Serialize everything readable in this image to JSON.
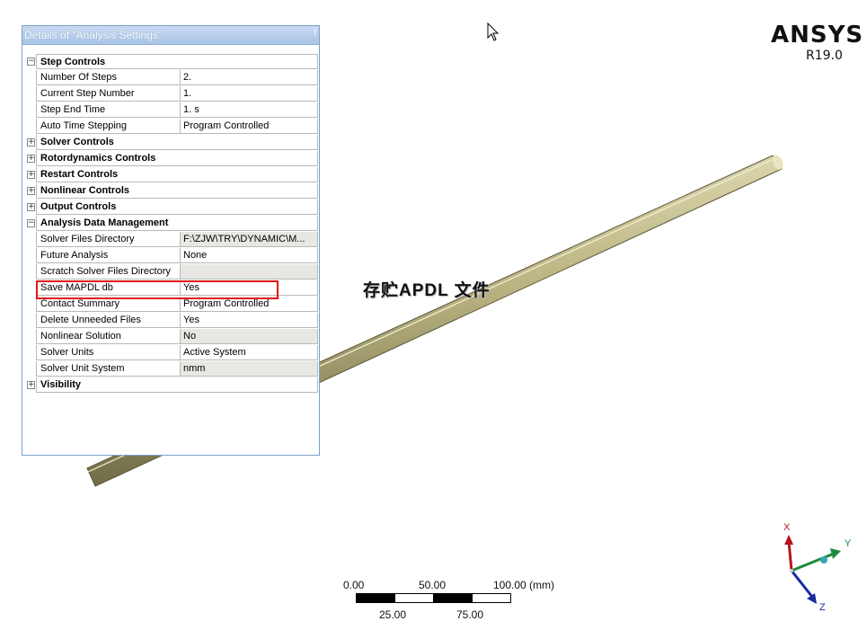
{
  "panel": {
    "title": "Details of \"Analysis Settings\"",
    "pin": "⫯"
  },
  "rows": [
    {
      "type": "category",
      "label": "Step Controls",
      "expanded": true
    },
    {
      "type": "prop",
      "label": "Number Of Steps",
      "value": "2."
    },
    {
      "type": "prop",
      "label": "Current Step Number",
      "value": "1."
    },
    {
      "type": "prop",
      "label": "Step End Time",
      "value": "1. s"
    },
    {
      "type": "prop",
      "label": "Auto Time Stepping",
      "value": "Program Controlled"
    },
    {
      "type": "category",
      "label": "Solver Controls",
      "expanded": false
    },
    {
      "type": "category",
      "label": "Rotordynamics Controls",
      "expanded": false
    },
    {
      "type": "category",
      "label": "Restart Controls",
      "expanded": false
    },
    {
      "type": "category",
      "label": "Nonlinear Controls",
      "expanded": false
    },
    {
      "type": "category",
      "label": "Output Controls",
      "expanded": false
    },
    {
      "type": "category",
      "label": "Analysis Data Management",
      "expanded": true
    },
    {
      "type": "prop",
      "label": "Solver Files Directory",
      "value": "F:\\ZJW\\TRY\\DYNAMIC\\M...",
      "grey": true
    },
    {
      "type": "prop",
      "label": "Future Analysis",
      "value": "None"
    },
    {
      "type": "prop",
      "label": "Scratch Solver Files Directory",
      "value": "",
      "grey": true
    },
    {
      "type": "prop",
      "label": "Save MAPDL db",
      "value": "Yes"
    },
    {
      "type": "prop",
      "label": "Contact Summary",
      "value": "Program Controlled"
    },
    {
      "type": "prop",
      "label": "Delete Unneeded Files",
      "value": "Yes"
    },
    {
      "type": "prop",
      "label": "Nonlinear Solution",
      "value": "No",
      "grey": true
    },
    {
      "type": "prop",
      "label": "Solver Units",
      "value": "Active System"
    },
    {
      "type": "prop",
      "label": "Solver Unit System",
      "value": "nmm",
      "grey": true
    },
    {
      "type": "category",
      "label": "Visibility",
      "expanded": false
    }
  ],
  "annotation": "存贮APDL 文件",
  "logo": {
    "brand": "ANSYS",
    "release": "R19.0"
  },
  "scale_bar": {
    "top_labels": [
      "0.00",
      "50.00",
      "100.00 (mm)"
    ],
    "bottom_labels": [
      "25.00",
      "75.00"
    ]
  },
  "triad": {
    "x": "X",
    "y": "Y",
    "z": "Z"
  },
  "colors": {
    "accent": "#e3141b",
    "beam": "#cfca9c",
    "panel_border": "#7aa0cc"
  }
}
